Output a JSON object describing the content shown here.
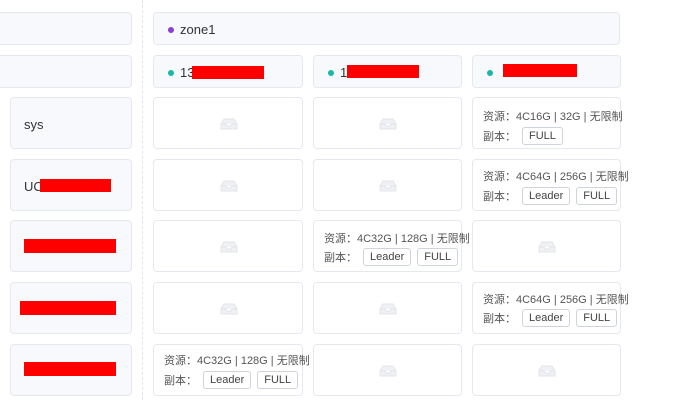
{
  "header": {
    "zone_label": "zone1",
    "zone_dot_color": "#8a3fd1"
  },
  "servers": [
    {
      "label_visible": "13",
      "dot_color": "#1bb7a6"
    },
    {
      "label_visible": "1",
      "dot_color": "#1bb7a6"
    },
    {
      "label_visible": "",
      "dot_color": "#1bb7a6"
    }
  ],
  "tenants": [
    {
      "name": "sys"
    },
    {
      "name": "UC"
    },
    {
      "name": ""
    },
    {
      "name": ""
    },
    {
      "name": ""
    }
  ],
  "labels": {
    "resource_prefix": "资源：",
    "replica_prefix": "副本："
  },
  "units": {
    "r1c3": {
      "resource": "4C16G | 32G | 无限制",
      "tags": [
        "FULL"
      ]
    },
    "r2c3": {
      "resource": "4C64G | 256G | 无限制",
      "tags": [
        "Leader",
        "FULL"
      ]
    },
    "r3c2": {
      "resource": "4C32G | 128G | 无限制",
      "tags": [
        "Leader",
        "FULL"
      ]
    },
    "r4c3": {
      "resource": "4C64G | 256G | 无限制",
      "tags": [
        "Leader",
        "FULL"
      ]
    },
    "r5c1": {
      "resource": "4C32G | 128G | 无限制",
      "tags": [
        "Leader",
        "FULL"
      ]
    }
  },
  "colors": {
    "card_bg": "#f8f9fc",
    "card_border": "#e6e8ef",
    "redaction": "#ff0000"
  }
}
